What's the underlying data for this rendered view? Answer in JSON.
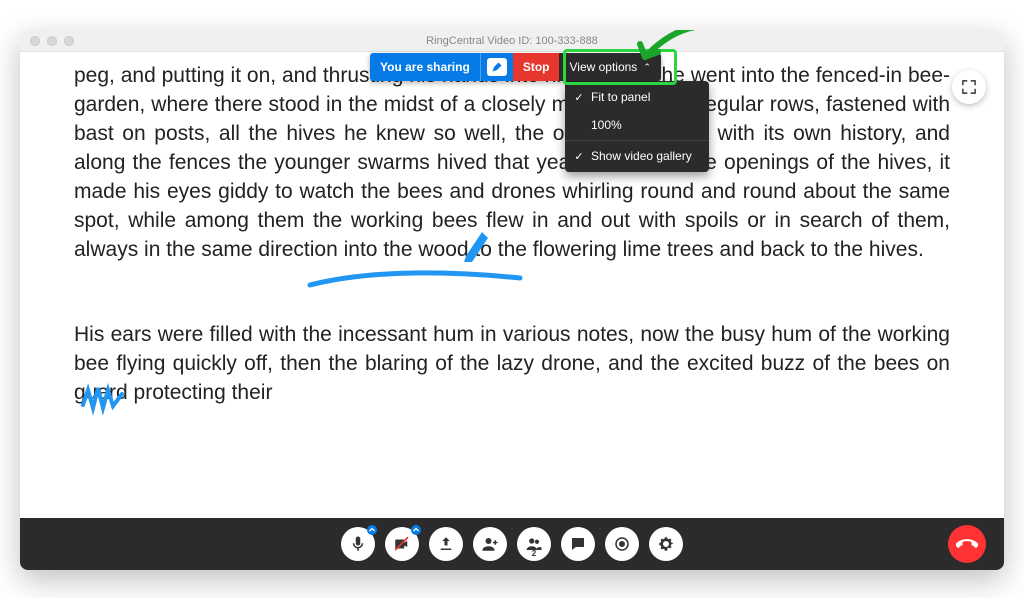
{
  "titlebar": {
    "title": "RingCentral Video ID: 100-333-888"
  },
  "share_toolbar": {
    "sharing_label": "You are sharing",
    "stop_label": "Stop",
    "view_options_label": "View options"
  },
  "view_dropdown": {
    "items": [
      {
        "label": "Fit to panel",
        "checked": true
      },
      {
        "label": "100%",
        "checked": false
      },
      {
        "label": "Show video gallery",
        "checked": true
      }
    ]
  },
  "document": {
    "paragraph1": "peg, and putting it on, and thrusting his hands into his pockets, he went into the fenced-in bee-garden, where there stood in the midst of a closely mown space in regular rows, fastened with bast on posts, all the hives he knew so well, the old stocks, each with its own history, and along the fences the younger swarms hived that year. In front of the openings of the hives, it made his eyes giddy to watch the bees and drones whirling round and round about the same spot, while among them the working bees flew in and out with spoils or in search of them, always in the same direction into the wood to the flowering lime trees and back to the hives.",
    "paragraph2": "His ears were filled with the incessant hum in various notes, now the busy hum of the working bee flying quickly off, then the blaring of the lazy drone, and the excited buzz of the bees on guard protecting their"
  },
  "bottom_toolbar": {
    "participants_count": "2"
  },
  "colors": {
    "blue": "#067ae6",
    "red_stop": "#e6362d",
    "dark": "#2b2b2b",
    "green_highlight": "#2bd63f",
    "annotation_blue": "#2196f3",
    "hangup_red": "#ff3333"
  }
}
